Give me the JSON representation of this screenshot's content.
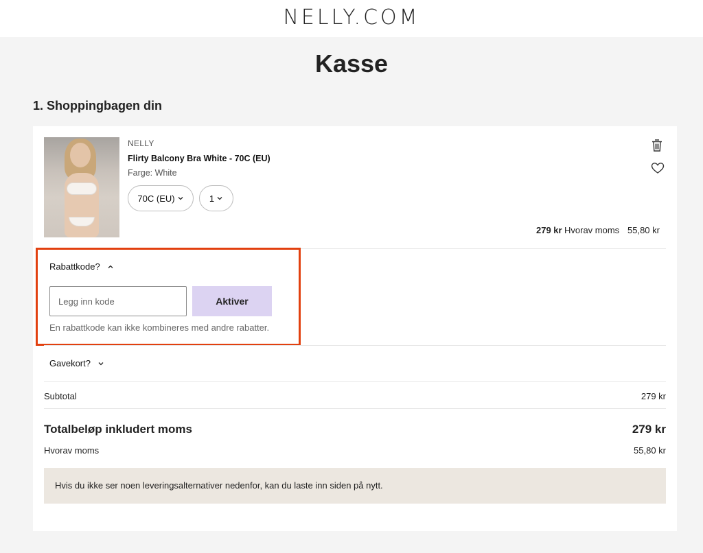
{
  "header": {
    "logo": "NELLY.COM"
  },
  "page": {
    "title": "Kasse"
  },
  "section": {
    "title": "1. Shoppingbagen din"
  },
  "product": {
    "brand": "NELLY",
    "name": "Flirty Balcony Bra White - 70C (EU)",
    "color": "Farge: White",
    "size": "70C (EU)",
    "quantity": "1",
    "price": "279 kr",
    "vat_label": "Hvorav moms",
    "vat_value": "55,80 kr"
  },
  "discount": {
    "toggle_label": "Rabattkode?",
    "placeholder": "Legg inn kode",
    "button_label": "Aktiver",
    "note": "En rabattkode kan ikke kombineres med andre rabatter."
  },
  "giftcard": {
    "toggle_label": "Gavekort?"
  },
  "summary": {
    "subtotal_label": "Subtotal",
    "subtotal_value": "279 kr",
    "total_label": "Totalbeløp inkludert moms",
    "total_value": "279 kr",
    "vat_label": "Hvorav moms",
    "vat_value": "55,80 kr"
  },
  "notice": {
    "text": "Hvis du ikke ser noen leveringsalternativer nedenfor, kan du laste inn siden på nytt."
  },
  "colors": {
    "accent_highlight": "#e2400f",
    "button_bg": "#dcd3f2",
    "notice_bg": "#ece7e0"
  },
  "icons": [
    "trash-icon",
    "heart-icon",
    "chevron-down-icon",
    "chevron-up-icon"
  ]
}
